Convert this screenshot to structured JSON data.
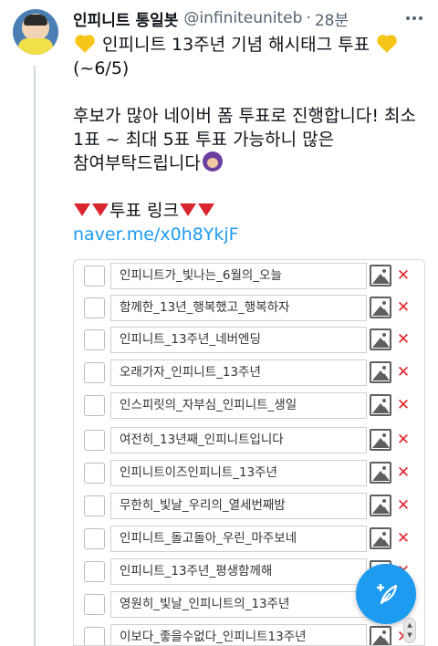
{
  "tweet": {
    "display_name": "인피니트 통일봇",
    "handle": "@infiniteuniteb",
    "separator": "·",
    "time": "28분",
    "line1": "인피니트 13주년 기념 해시태그 투표",
    "line2": "(~6/5)",
    "line3": "후보가 많아 네이버 폼 투표로 진행합니다! 최소",
    "line4": "1표 ~ 최대 5표 투표 가능하니 많은",
    "line5": "참여부탁드립니다",
    "vote_link_label": "투표 링크",
    "link": "naver.me/x0h8YkjF"
  },
  "icons": {
    "more": "more-horizontal-icon",
    "heart": "yellow-heart-icon",
    "bow": "person-bowing-icon",
    "triangle": "red-triangle-down-icon",
    "image": "image-icon",
    "delete": "close-x-icon",
    "compose": "compose-feather-icon"
  },
  "form": {
    "delete_glyph": "✕",
    "options": [
      "인피니트가_빛나는_6월의_오늘",
      "함께한_13년_행복했고_행복하자",
      "인피니트_13주년_네버엔딩",
      "오래가자_인피니트_13주년",
      "인스피릿의_자부심_인피니트_생일",
      "여전히_13년째_인피니트입니다",
      "인피니트이즈인피니트_13주년",
      "무한히_빛날_우리의_열세번째밤",
      "인피니트_돌고돌아_우린_마주보네",
      "인피니트_13주년_평생함께해",
      "영원히_빛날_인피니트의_13주년",
      "이보다_좋을수없다_인피니트13주년"
    ]
  },
  "scroll": {
    "up": "▲",
    "down": "▼"
  },
  "colors": {
    "link": "#1d9bf0",
    "delete": "#e0262b",
    "fab": "#1d9bf0"
  }
}
